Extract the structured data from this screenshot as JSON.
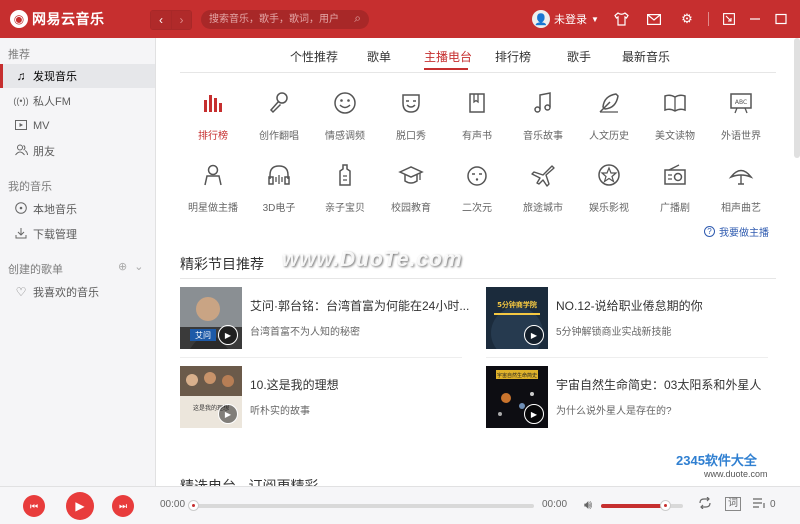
{
  "app": {
    "name": "网易云音乐"
  },
  "search": {
    "placeholder": "搜索音乐，歌手，歌词，用户"
  },
  "user": {
    "label": "未登录"
  },
  "sidebar": {
    "sections": [
      {
        "title": "推荐"
      },
      {
        "title": "我的音乐"
      },
      {
        "title": "创建的歌单"
      }
    ],
    "items": [
      {
        "label": "发现音乐",
        "icon": "music-note-icon"
      },
      {
        "label": "私人FM",
        "icon": "radio-waves-icon"
      },
      {
        "label": "MV",
        "icon": "video-icon"
      },
      {
        "label": "朋友",
        "icon": "friends-icon"
      },
      {
        "label": "本地音乐",
        "icon": "disc-icon"
      },
      {
        "label": "下载管理",
        "icon": "download-icon"
      },
      {
        "label": "我喜欢的音乐",
        "icon": "heart-icon"
      }
    ]
  },
  "tabs": [
    "个性推荐",
    "歌单",
    "主播电台",
    "排行榜",
    "歌手",
    "最新音乐"
  ],
  "active_tab": "主播电台",
  "categories": [
    "排行榜",
    "创作翻唱",
    "情感调频",
    "脱口秀",
    "有声书",
    "音乐故事",
    "人文历史",
    "美文读物",
    "外语世界",
    "明星做主播",
    "3D电子",
    "亲子宝贝",
    "校园教育",
    "二次元",
    "旅途城市",
    "娱乐影视",
    "广播剧",
    "相声曲艺"
  ],
  "apply_link": "我要做主播",
  "section1": {
    "title": "精彩节目推荐"
  },
  "programs": [
    {
      "title": "艾问·郭台铭：台湾首富为何能在24小时...",
      "subtitle": "台湾首富不为人知的秘密",
      "thumb_text": "艾问"
    },
    {
      "title": "NO.12-说给职业倦怠期的你",
      "subtitle": "5分钟解锁商业实战新技能",
      "thumb_text": "5分钟商学院"
    },
    {
      "title": "10.这是我的理想",
      "subtitle": "听朴实的故事",
      "thumb_text": "这是我的理想"
    },
    {
      "title": "宇宙自然生命简史：03太阳系和外星人",
      "subtitle": "为什么说外星人是存在的?",
      "thumb_text": "宇宙自然生命简史"
    }
  ],
  "section2": {
    "title": "精选电台 - 订阅更精彩"
  },
  "player": {
    "time_current": "00:00",
    "time_total": "00:00",
    "progress": 0,
    "volume": 0.78,
    "lyric_label": "词",
    "playlist_count": "0"
  },
  "watermarks": {
    "duote": "www.DuoTe.com",
    "brand": "2345软件大全",
    "site": "www.duote.com"
  },
  "colors": {
    "accent": "#c62f2f",
    "link": "#2f5bb0"
  }
}
